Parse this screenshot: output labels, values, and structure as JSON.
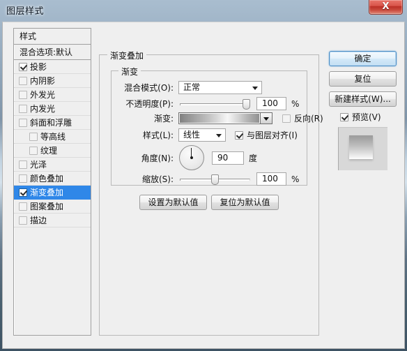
{
  "window": {
    "title": "图层样式",
    "close_label": "X"
  },
  "styles_panel": {
    "header": "样式",
    "blend_options": {
      "label": "混合选项:默认",
      "checkbox": false
    },
    "items": [
      {
        "label": "投影",
        "checked": true,
        "indent": false
      },
      {
        "label": "内阴影",
        "checked": false,
        "indent": false
      },
      {
        "label": "外发光",
        "checked": false,
        "indent": false
      },
      {
        "label": "内发光",
        "checked": false,
        "indent": false
      },
      {
        "label": "斜面和浮雕",
        "checked": false,
        "indent": false
      },
      {
        "label": "等高线",
        "checked": false,
        "indent": true
      },
      {
        "label": "纹理",
        "checked": false,
        "indent": true
      },
      {
        "label": "光泽",
        "checked": false,
        "indent": false
      },
      {
        "label": "颜色叠加",
        "checked": false,
        "indent": false
      },
      {
        "label": "渐变叠加",
        "checked": true,
        "indent": false,
        "selected": true
      },
      {
        "label": "图案叠加",
        "checked": false,
        "indent": false
      },
      {
        "label": "描边",
        "checked": false,
        "indent": false
      }
    ]
  },
  "main": {
    "group_title": "渐变叠加",
    "sub_group_title": "渐变",
    "blend_mode": {
      "label": "混合模式(O):",
      "value": "正常"
    },
    "opacity": {
      "label": "不透明度(P):",
      "value": "100",
      "unit": "%",
      "percent": 100
    },
    "gradient": {
      "label": "渐变:",
      "reverse_label": "反向(R)",
      "reverse_checked": false
    },
    "style": {
      "label": "样式(L):",
      "value": "线性",
      "align_label": "与图层对齐(I)",
      "align_checked": true
    },
    "angle": {
      "label": "角度(N):",
      "value": "90",
      "unit": "度",
      "degrees": 90
    },
    "scale": {
      "label": "缩放(S):",
      "value": "100",
      "unit": "%",
      "percent": 50
    },
    "set_default_label": "设置为默认值",
    "reset_default_label": "复位为默认值"
  },
  "side": {
    "ok_label": "确定",
    "reset_label": "复位",
    "new_style_label": "新建样式(W)...",
    "preview_label": "预览(V)",
    "preview_checked": true
  },
  "colors": {
    "selection": "#2f87e8",
    "dialog_bg": "#efefef",
    "close_red": "#c93a2e"
  }
}
